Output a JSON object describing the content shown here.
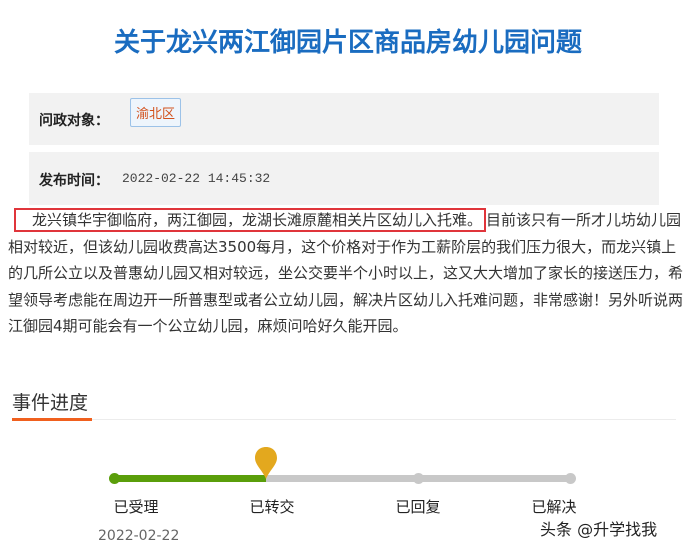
{
  "title": "关于龙兴两江御园片区商品房幼儿园问题",
  "info": {
    "target_label": "问政对象：",
    "target_value": "渝北区",
    "time_label": "发布时间：",
    "time_value": "2022-02-22 14:45:32"
  },
  "content": {
    "highlight": "龙兴镇华宇御临府，两江御园，龙湖长滩原麓相关片区幼儿入托难。",
    "rest": "目前该只有一所才儿坊幼儿园相对较近，但该幼儿园收费高达3500每月，这个价格对于作为工薪阶层的我们压力很大，而龙兴镇上的几所公立以及普惠幼儿园又相对较远，坐公交要半个小时以上，这又大大增加了家长的接送压力，希望领导考虑能在周边开一所普惠型或者公立幼儿园，解决片区幼儿入托难问题，非常感谢！另外听说两江御园4期可能会有一个公立幼儿园，麻烦问哈好久能开园。"
  },
  "progress": {
    "title": "事件进度",
    "steps": [
      {
        "label": "已受理",
        "date": "2022-02-22"
      },
      {
        "label": "已转交"
      },
      {
        "label": "已回复"
      },
      {
        "label": "已解决"
      }
    ],
    "current_step": 2,
    "colors": {
      "done": "#5a9e0a",
      "pending": "#c8c8c8",
      "current": "#e3a81e"
    }
  },
  "watermark": "头条 @升学找我"
}
